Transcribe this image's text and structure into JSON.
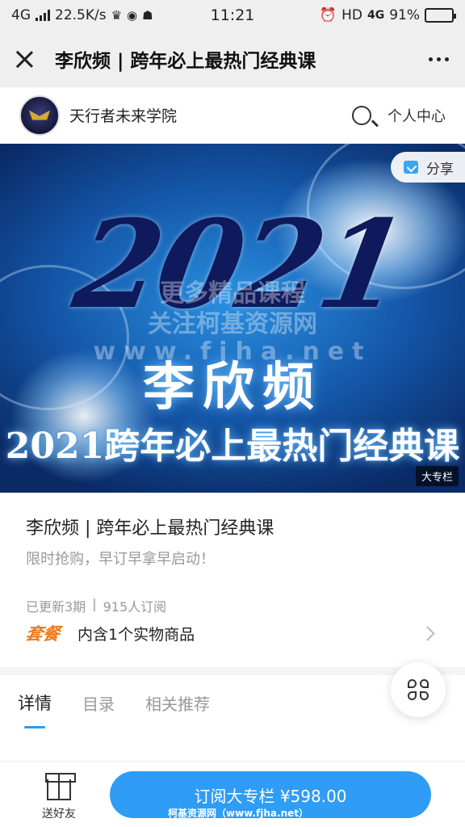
{
  "status_bar": {
    "network_left": "4G",
    "speed": "22.5K/s",
    "time": "11:21",
    "hd": "HD",
    "network_right": "4G",
    "battery": "91%",
    "battery_level": 0.91
  },
  "title_bar": {
    "title": "李欣频 | 跨年必上最热门经典课"
  },
  "site_header": {
    "brand_name": "天行者未来学院",
    "profile_label": "个人中心"
  },
  "banner": {
    "year": "2021",
    "name_text": "李欣频",
    "course_text": "2021跨年必上最热门经典课",
    "share_label": "分享",
    "column_tag": "大专栏",
    "watermark_1": "更多精品课程",
    "watermark_2": "关注柯基资源网",
    "watermark_3": "www.fjha.net"
  },
  "course": {
    "title": "李欣频 | 跨年必上最热门经典课",
    "subtitle": "限时抢购，早订早拿早启动！",
    "updated": "已更新3期",
    "separator": "|",
    "subscribers": "915人订阅",
    "package_tag": "套餐",
    "package_text": "内含1个实物商品"
  },
  "tabs": [
    {
      "label": "详情",
      "active": true
    },
    {
      "label": "目录",
      "active": false
    },
    {
      "label": "相关推荐",
      "active": false
    }
  ],
  "bottom_bar": {
    "gift_label": "送好友",
    "subscribe_label": "订阅大专栏 ¥598.00",
    "watermark": "柯基资源网（www.fjha.net）"
  },
  "colors": {
    "accent": "#2f9cf5",
    "package_tag": "#f07b1c"
  }
}
